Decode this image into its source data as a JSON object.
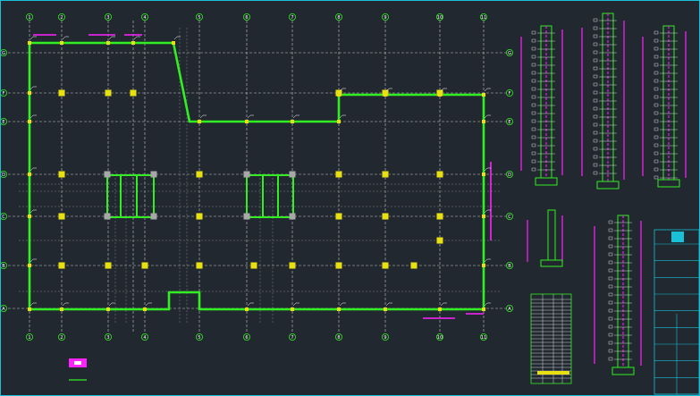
{
  "drawing": {
    "background": "#212830",
    "colors": {
      "wall": "#33ee22",
      "axis": "#c8c8c8",
      "dash": "#8a8a8a",
      "column": "#e8e010",
      "column_gray": "#a8a8a8",
      "magenta": "#ff22ff",
      "cyan": "#18c0d8",
      "white": "#ffffff",
      "bubble": "#33ee22"
    },
    "icons": [
      "axis-bubble-icon",
      "column-icon",
      "north-arrow-icon"
    ]
  },
  "plan": {
    "top_axis_labels": [
      "1",
      "2",
      "3",
      "4",
      "5",
      "6",
      "7",
      "8",
      "9",
      "10",
      "11"
    ],
    "bottom_axis_labels": [
      "1",
      "2",
      "3",
      "4",
      "5",
      "6",
      "7",
      "8",
      "9",
      "10",
      "11"
    ],
    "left_axis_labels": [
      "G",
      "F",
      "E",
      "D",
      "C",
      "B",
      "A"
    ],
    "right_axis_labels": [
      "G",
      "F",
      "E",
      "D",
      "C",
      "B",
      "A"
    ]
  },
  "sections": {
    "count": 5,
    "notes": [
      "C20",
      "C25",
      "C30"
    ]
  },
  "title_block": {
    "rows": 9
  }
}
